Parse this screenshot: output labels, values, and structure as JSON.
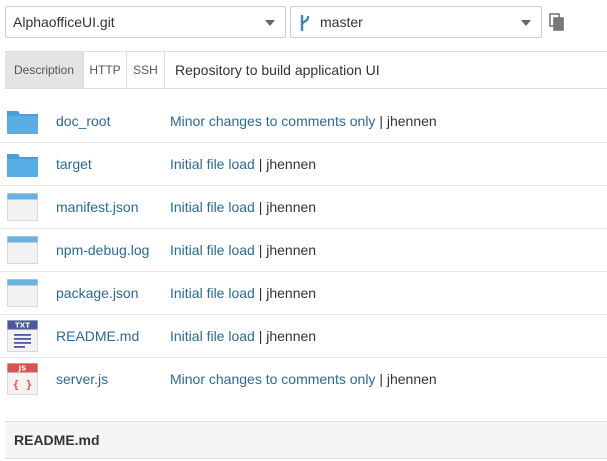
{
  "repo_select": {
    "value": "AlphaofficeUI.git"
  },
  "branch_select": {
    "value": "master",
    "icon": "branch-icon"
  },
  "copy_button": {
    "icon": "copy-icon"
  },
  "tabs": [
    {
      "label": "Description",
      "active": true
    },
    {
      "label": "HTTP",
      "active": false
    },
    {
      "label": "SSH",
      "active": false
    }
  ],
  "description": "Repository to build application UI",
  "files": [
    {
      "name": "doc_root",
      "type": "folder",
      "message": "Minor changes to comments only",
      "author": "jhennen"
    },
    {
      "name": "target",
      "type": "folder",
      "message": "Initial file load",
      "author": "jhennen"
    },
    {
      "name": "manifest.json",
      "type": "file",
      "message": "Initial file load",
      "author": "jhennen"
    },
    {
      "name": "npm-debug.log",
      "type": "file",
      "message": "Initial file load",
      "author": "jhennen"
    },
    {
      "name": "package.json",
      "type": "file",
      "message": "Initial file load",
      "author": "jhennen"
    },
    {
      "name": "README.md",
      "type": "txt",
      "badge": "TXT",
      "message": "Initial file load",
      "author": "jhennen"
    },
    {
      "name": "server.js",
      "type": "js",
      "badge": "JS",
      "badge_glyph": "{ }",
      "message": "Minor changes to comments only",
      "author": "jhennen"
    }
  ],
  "separator": "|",
  "readme_header": "README.md",
  "colors": {
    "link": "#2a6a96",
    "folder": "#4a9fd8",
    "file_header": "#6ab0e0",
    "txt_badge": "#4a5a9a",
    "js_badge": "#d9534f",
    "branch_icon": "#3a87c8"
  }
}
